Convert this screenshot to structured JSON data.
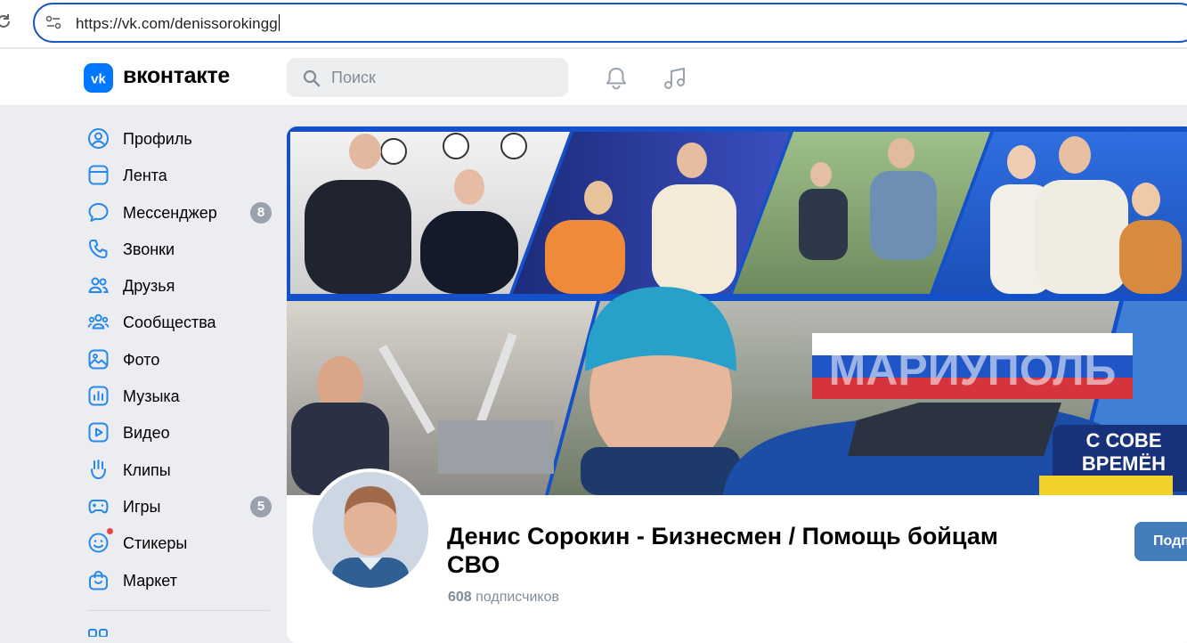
{
  "browser": {
    "url": "https://vk.com/denissorokingg"
  },
  "header": {
    "logo_text": "вконтакте",
    "search_placeholder": "Поиск"
  },
  "sidebar": {
    "items": [
      {
        "label": "Профиль",
        "icon": "profile-icon"
      },
      {
        "label": "Лента",
        "icon": "feed-icon"
      },
      {
        "label": "Мессенджер",
        "icon": "messenger-icon",
        "badge": "8"
      },
      {
        "label": "Звонки",
        "icon": "phone-icon"
      },
      {
        "label": "Друзья",
        "icon": "friends-icon"
      },
      {
        "label": "Сообщества",
        "icon": "communities-icon"
      },
      {
        "label": "Фото",
        "icon": "photo-icon"
      },
      {
        "label": "Музыка",
        "icon": "music-icon"
      },
      {
        "label": "Видео",
        "icon": "video-icon"
      },
      {
        "label": "Клипы",
        "icon": "clips-icon"
      },
      {
        "label": "Игры",
        "icon": "games-icon",
        "badge": "5"
      },
      {
        "label": "Стикеры",
        "icon": "stickers-icon"
      },
      {
        "label": "Маркет",
        "icon": "market-icon"
      }
    ]
  },
  "profile": {
    "name": "Денис Сорокин - Бизнесмен / Помощь бойцам СВО",
    "followers_count": "608",
    "followers_label": "подписчиков",
    "subscribe_label": "Подписаться"
  },
  "cover": {
    "tiles": [
      {
        "kind": "photo-collage-tile",
        "caption": ""
      },
      {
        "kind": "photo-collage-tile",
        "caption": ""
      },
      {
        "kind": "photo-collage-tile",
        "caption": ""
      },
      {
        "kind": "photo-collage-tile",
        "caption": ""
      },
      {
        "kind": "photo-collage-tile",
        "caption": ""
      },
      {
        "kind": "photo-collage-tile",
        "caption": ""
      }
    ],
    "sign_text": "МАРИУПОЛЬ",
    "car_text_line1": "С СОВЕ",
    "car_text_line2": "ВРЕМЁН"
  },
  "colors": {
    "accent": "#0077ff",
    "button": "#447bba",
    "badge": "#99a2ad",
    "cover_blue": "#1450c8",
    "address_border": "#1a56c4"
  }
}
